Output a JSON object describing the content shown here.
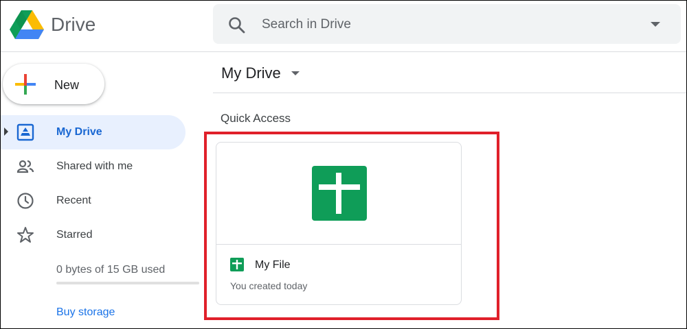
{
  "app": {
    "brand": "Drive"
  },
  "search": {
    "placeholder": "Search in Drive"
  },
  "sidebar": {
    "new_label": "New",
    "items": [
      {
        "label": "My Drive",
        "icon": "my-drive-icon",
        "active": true
      },
      {
        "label": "Shared with me",
        "icon": "people-icon",
        "active": false
      },
      {
        "label": "Recent",
        "icon": "clock-icon",
        "active": false
      },
      {
        "label": "Starred",
        "icon": "star-icon",
        "active": false
      }
    ],
    "storage": {
      "text": "0 bytes of 15 GB used",
      "used_fraction": 0
    },
    "buy_storage": "Buy storage"
  },
  "main": {
    "title": "My Drive",
    "section": "Quick Access",
    "files": [
      {
        "name": "My File",
        "subtitle": "You created today",
        "icon": "google-sheets-icon"
      }
    ]
  },
  "colors": {
    "accent": "#1a73e8",
    "active_bg": "#e8f0fe",
    "sheets_green": "#0f9d58",
    "highlight_red": "#e0202a"
  }
}
